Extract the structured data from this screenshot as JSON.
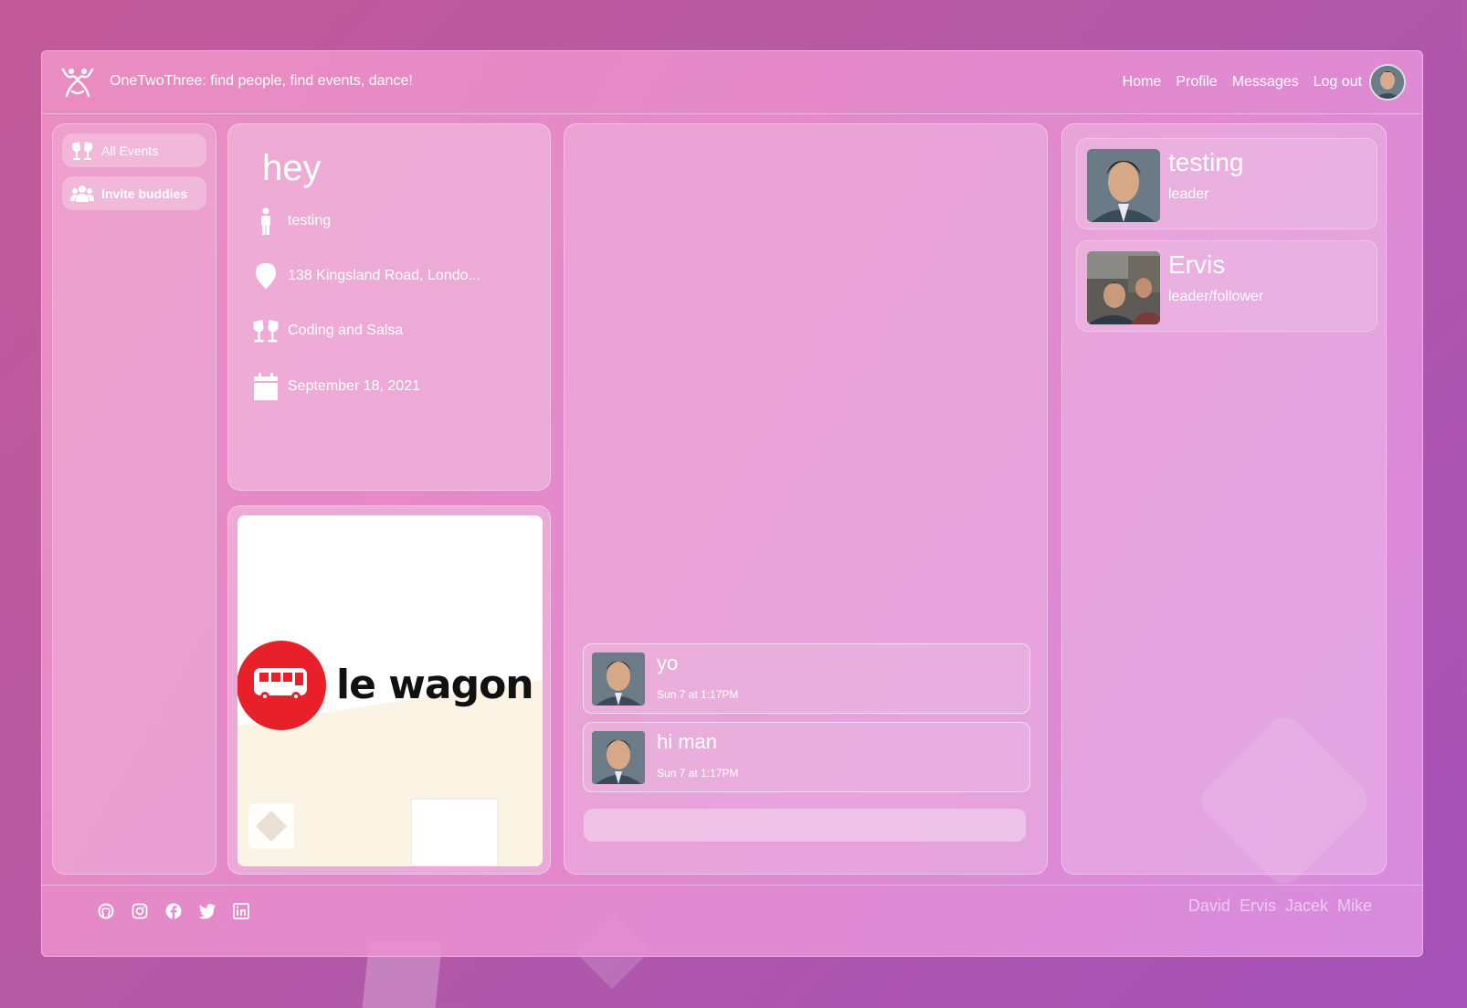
{
  "brand": {
    "title": "OneTwoThree: find people, find events, dance!",
    "logo": "dancers-logo-icon"
  },
  "nav": {
    "links": [
      "Home",
      "Profile",
      "Messages",
      "Log out"
    ],
    "avatar": "user-avatar"
  },
  "sidebar": {
    "items": [
      {
        "label": "All Events",
        "icon": "cheers-icon"
      },
      {
        "label": "Invite buddies",
        "icon": "users-icon"
      }
    ]
  },
  "event": {
    "title": "hey",
    "host": "testing",
    "address": "138 Kingsland Road, Londo...",
    "category": "Coding and Salsa",
    "date": "September 18, 2021",
    "image_text": "le wagon"
  },
  "chat": {
    "messages": [
      {
        "text": "yo",
        "time": "Sun 7 at 1:17PM"
      },
      {
        "text": "hi man",
        "time": "Sun 7 at 1:17PM"
      }
    ],
    "input_placeholder": ""
  },
  "members": [
    {
      "name": "testing",
      "role": "leader"
    },
    {
      "name": "Ervis",
      "role": "leader/follower"
    }
  ],
  "footer": {
    "social": [
      "github-icon",
      "instagram-icon",
      "facebook-icon",
      "twitter-icon",
      "linkedin-icon"
    ],
    "team": [
      "David",
      "Ervis",
      "Jacek",
      "Mike"
    ]
  },
  "colors": {
    "accent_red": "#e8202a",
    "background": "#b75aa4"
  }
}
